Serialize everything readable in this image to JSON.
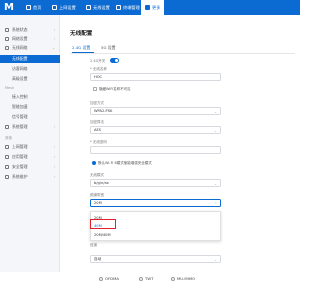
{
  "topbar": {
    "logo": "M",
    "tabs": [
      {
        "label": "首页",
        "icon": "home-icon"
      },
      {
        "label": "上网设置",
        "icon": "globe-icon"
      },
      {
        "label": "无线设置",
        "icon": "wifi-icon"
      },
      {
        "label": "终端管理",
        "icon": "device-icon"
      },
      {
        "label": "更多",
        "icon": "more-icon"
      }
    ]
  },
  "sidebar": {
    "items": [
      {
        "label": "系统状态",
        "icon": "status-icon"
      },
      {
        "label": "网络设置",
        "icon": "network-icon"
      },
      {
        "label": "无线网络",
        "icon": "wifi-icon",
        "expanded": true
      }
    ],
    "subitems": [
      {
        "label": "无线配置",
        "active": true
      },
      {
        "label": "访客网络"
      },
      {
        "label": "高级设置"
      }
    ],
    "section_label": "Mesh",
    "subitems2": [
      {
        "label": "接入控制"
      },
      {
        "label": "智能加速"
      },
      {
        "label": "信号管理"
      }
    ],
    "item_mid": {
      "label": "系统管理",
      "icon": "gear-icon"
    },
    "section_label2": "其他",
    "items2": [
      {
        "label": "上网管理",
        "icon": "manage-icon"
      },
      {
        "label": "应用管理",
        "icon": "app-icon"
      },
      {
        "label": "安全管理",
        "icon": "shield-icon"
      },
      {
        "label": "系统维护",
        "icon": "tool-icon"
      }
    ]
  },
  "main": {
    "title": "无线配置",
    "tabs": [
      {
        "label": "2.4G 设置",
        "active": true
      },
      {
        "label": "5G 设置"
      }
    ],
    "wifi_switch_label": "2.4G开关",
    "ssid_label": "* 无线名称",
    "ssid_value": "HOC",
    "hide_ssid_label": "隐藏WiFi名称不可见",
    "security_label": "加密方式",
    "security_value": "WPA2-PSK",
    "encrypt_label": "加密算法",
    "encrypt_value": "AES",
    "password_label": "* 无线密码",
    "password_value": "",
    "wpa3_label": "默认Wi-Fi 6模式使能增强安全模式",
    "mode_label": "无线模式",
    "mode_value": "b/g/n/ax",
    "bandwidth_label": "频道带宽",
    "bandwidth_value": "20M",
    "options": [
      "20M",
      "40M",
      "20M/40M"
    ],
    "selected_option": "40M",
    "channel_label": "信道",
    "channel_value": "自动",
    "bottom_options": [
      "OFDMA",
      "TWT",
      "MU-MIMO"
    ]
  },
  "colors": {
    "accent": "#0b6bd3",
    "highlight": "#e0202a"
  }
}
